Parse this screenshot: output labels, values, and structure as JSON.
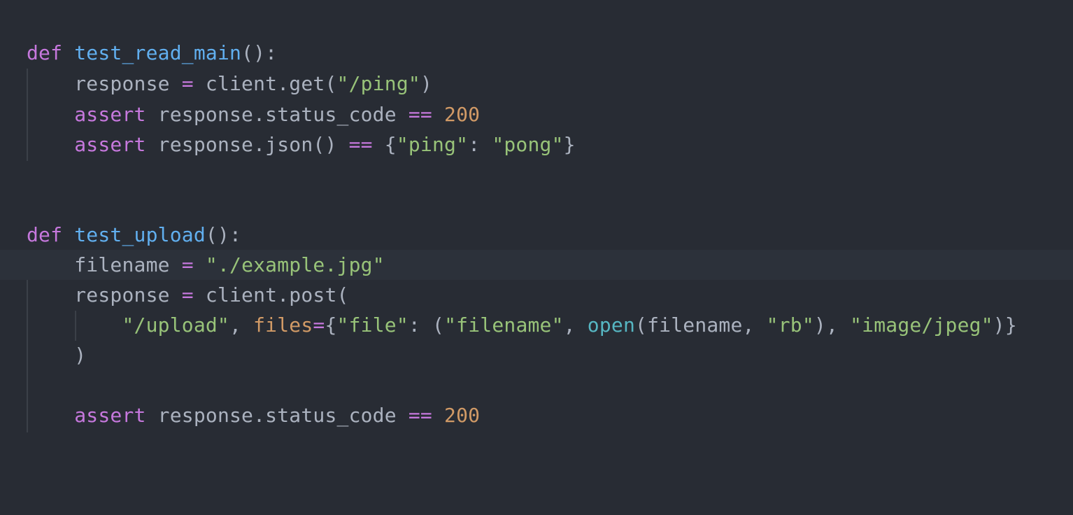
{
  "editor": {
    "theme": "one-dark",
    "colors": {
      "background": "#282c34",
      "current_line": "#2c313a",
      "indent_guide": "#3b4048",
      "keyword": "#c678dd",
      "function": "#61afef",
      "string": "#98c379",
      "number": "#d19a66",
      "builtin": "#56b6c2",
      "text": "#abb2bf"
    },
    "code": {
      "f1_def": "def",
      "f1_name": "test_read_main",
      "f1_sig": "():",
      "l2_a": "response ",
      "l2_eq": "=",
      "l2_b": " client.get(",
      "l2_str": "\"/ping\"",
      "l2_c": ")",
      "l3_kw": "assert",
      "l3_a": " response.status_code ",
      "l3_op": "==",
      "l3_sp": " ",
      "l3_num": "200",
      "l4_kw": "assert",
      "l4_a": " response.json() ",
      "l4_op": "==",
      "l4_b": " {",
      "l4_s1": "\"ping\"",
      "l4_c": ": ",
      "l4_s2": "\"pong\"",
      "l4_d": "}",
      "f2_def": "def",
      "f2_name": "test_upload",
      "f2_sig": "():",
      "l7_a": "filename ",
      "l7_eq": "=",
      "l7_sp": " ",
      "l7_str": "\"./example.jpg\"",
      "l8_a": "response ",
      "l8_eq": "=",
      "l8_b": " client.post(",
      "l9_s1": "\"/upload\"",
      "l9_a": ", ",
      "l9_param": "files",
      "l9_eq": "=",
      "l9_b": "{",
      "l9_s2": "\"file\"",
      "l9_c": ": (",
      "l9_s3": "\"filename\"",
      "l9_d": ", ",
      "l9_bi": "open",
      "l9_e": "(filename, ",
      "l9_s4": "\"rb\"",
      "l9_f": "), ",
      "l9_s5": "\"image/jpeg\"",
      "l9_g": ")}",
      "l10": ")",
      "l12_kw": "assert",
      "l12_a": " response.status_code ",
      "l12_op": "==",
      "l12_sp": " ",
      "l12_num": "200"
    }
  }
}
